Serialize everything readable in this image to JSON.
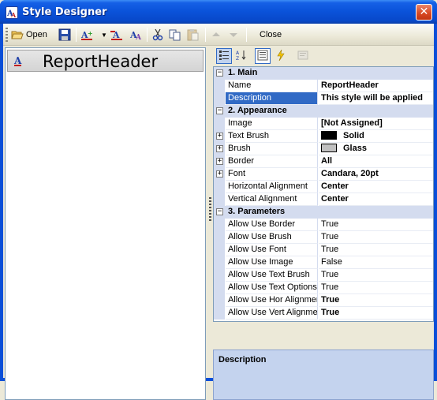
{
  "window": {
    "title": "Style Designer",
    "close_glyph": "✕"
  },
  "toolbar": {
    "open_label": "Open",
    "close_label": "Close",
    "icons": [
      "open-folder-icon",
      "save-icon",
      "add-style-icon",
      "dropdown-arrow-icon",
      "remove-style-icon",
      "style-list-icon",
      "cut-icon",
      "copy-icon",
      "paste-icon",
      "move-up-icon",
      "move-down-icon"
    ]
  },
  "preview": {
    "icon_text": "A",
    "text": "ReportHeader"
  },
  "property_grid": {
    "toolbar_icons": [
      "categorized-icon",
      "alphabetical-icon",
      "properties-icon",
      "events-icon",
      "property-pages-icon"
    ],
    "categories": [
      {
        "label": "1. Main",
        "toggle": "−",
        "properties": [
          {
            "name": "Name",
            "value": "ReportHeader",
            "bold": true
          },
          {
            "name": "Description",
            "value": "This style will be applied",
            "bold": true,
            "selected": true
          }
        ]
      },
      {
        "label": "2. Appearance",
        "toggle": "−",
        "properties": [
          {
            "name": "Image",
            "value": "[Not Assigned]",
            "bold": true
          },
          {
            "name": "Text Brush",
            "value": "Solid",
            "bold": true,
            "expandable": true,
            "swatch": "#000000"
          },
          {
            "name": "Brush",
            "value": "Glass",
            "bold": true,
            "expandable": true,
            "swatch": "#c0c0c0"
          },
          {
            "name": "Border",
            "value": "All",
            "bold": true,
            "expandable": true
          },
          {
            "name": "Font",
            "value": "Candara, 20pt",
            "bold": true,
            "expandable": true
          },
          {
            "name": "Horizontal Alignment",
            "value": "Center",
            "bold": true
          },
          {
            "name": "Vertical Alignment",
            "value": "Center",
            "bold": true
          }
        ]
      },
      {
        "label": "3. Parameters",
        "toggle": "−",
        "properties": [
          {
            "name": "Allow Use Border",
            "value": "True",
            "bold": false
          },
          {
            "name": "Allow Use Brush",
            "value": "True",
            "bold": false
          },
          {
            "name": "Allow Use Font",
            "value": "True",
            "bold": false
          },
          {
            "name": "Allow Use Image",
            "value": "False",
            "bold": false
          },
          {
            "name": "Allow Use Text Brush",
            "value": "True",
            "bold": false
          },
          {
            "name": "Allow Use Text Options",
            "value": "True",
            "bold": false
          },
          {
            "name": "Allow Use Hor Alignment",
            "value": "True",
            "bold": true
          },
          {
            "name": "Allow Use Vert Alignment",
            "value": "True",
            "bold": true
          }
        ]
      }
    ],
    "expander_glyph": "+"
  },
  "description_panel": {
    "title": "Description"
  },
  "colors": {
    "titlebar": "#0a52d9",
    "selection": "#316ac5",
    "category_band": "#d4dcef",
    "description_panel": "#c4d3ee"
  }
}
